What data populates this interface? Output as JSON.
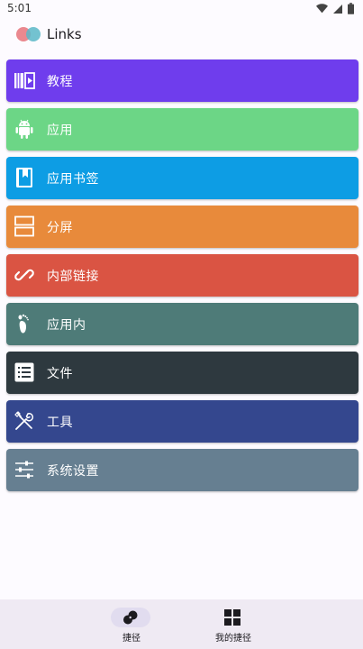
{
  "status_bar": {
    "time": "5:01"
  },
  "app": {
    "title": "Links",
    "logo_colors": [
      "#e87b83",
      "#5bb7c8"
    ]
  },
  "items": [
    {
      "label": "教程",
      "icon": "video-book-icon",
      "color": "#6f3ded"
    },
    {
      "label": "应用",
      "icon": "android-icon",
      "color": "#6cd686"
    },
    {
      "label": "应用书签",
      "icon": "bookmark-book-icon",
      "color": "#0d9de4"
    },
    {
      "label": "分屏",
      "icon": "split-screen-icon",
      "color": "#e88a3b"
    },
    {
      "label": "内部链接",
      "icon": "link-icon",
      "color": "#da5443"
    },
    {
      "label": "应用内",
      "icon": "footprint-icon",
      "color": "#4e7b78"
    },
    {
      "label": "文件",
      "icon": "list-file-icon",
      "color": "#2e393f"
    },
    {
      "label": "工具",
      "icon": "tools-icon",
      "color": "#34478e"
    },
    {
      "label": "系统设置",
      "icon": "sliders-icon",
      "color": "#667f91"
    }
  ],
  "bottom_nav": {
    "items": [
      {
        "label": "捷径",
        "icon": "shortcut-icon",
        "selected": true
      },
      {
        "label": "我的捷径",
        "icon": "grid-icon",
        "selected": false
      }
    ]
  }
}
